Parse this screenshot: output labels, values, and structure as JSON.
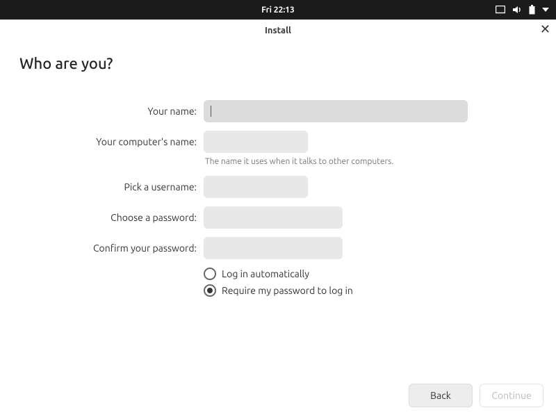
{
  "topbar": {
    "clock": "Fri 22:13"
  },
  "window": {
    "title": "Install"
  },
  "page": {
    "heading": "Who are you?"
  },
  "form": {
    "your_name_label": "Your name:",
    "your_name_value": "",
    "computer_name_label": "Your computer's name:",
    "computer_name_value": "",
    "computer_name_hint": "The name it uses when it talks to other computers.",
    "username_label": "Pick a username:",
    "username_value": "",
    "password_label": "Choose a password:",
    "password_value": "",
    "confirm_label": "Confirm your password:",
    "confirm_value": ""
  },
  "login_options": {
    "auto_label": "Log in automatically",
    "require_label": "Require my password to log in",
    "selected": "require"
  },
  "footer": {
    "back": "Back",
    "continue": "Continue"
  }
}
